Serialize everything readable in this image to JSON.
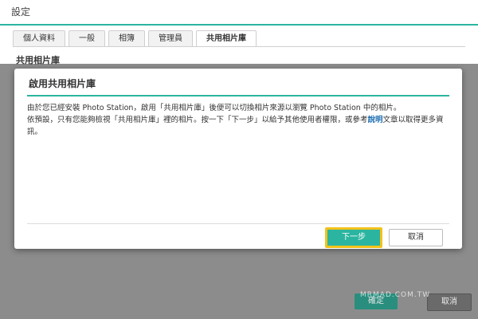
{
  "header": {
    "title": "設定"
  },
  "tabs": [
    {
      "label": "個人資料"
    },
    {
      "label": "一般"
    },
    {
      "label": "相簿"
    },
    {
      "label": "管理員"
    },
    {
      "label": "共用相片庫"
    }
  ],
  "section": {
    "title": "共用相片庫"
  },
  "dialog": {
    "title": "啟用共用相片庫",
    "line1": "由於您已經安裝 Photo Station，啟用「共用相片庫」後便可以切換相片來源以瀏覽 Photo Station 中的相片。",
    "line2_pre": "依預設，只有您能夠檢視「共用相片庫」裡的相片。按一下「下一步」以給予其他使用者權限，或參考",
    "link": "說明",
    "line2_post": "文章以取得更多資訊。",
    "next_button": "下一步",
    "cancel_button": "取消"
  },
  "footer": {
    "ok_button": "確定",
    "cancel_button": "取消"
  },
  "watermark": "MRMAD.COM.TW",
  "colors": {
    "accent": "#2bb5a0",
    "highlight": "#f2c21a"
  }
}
